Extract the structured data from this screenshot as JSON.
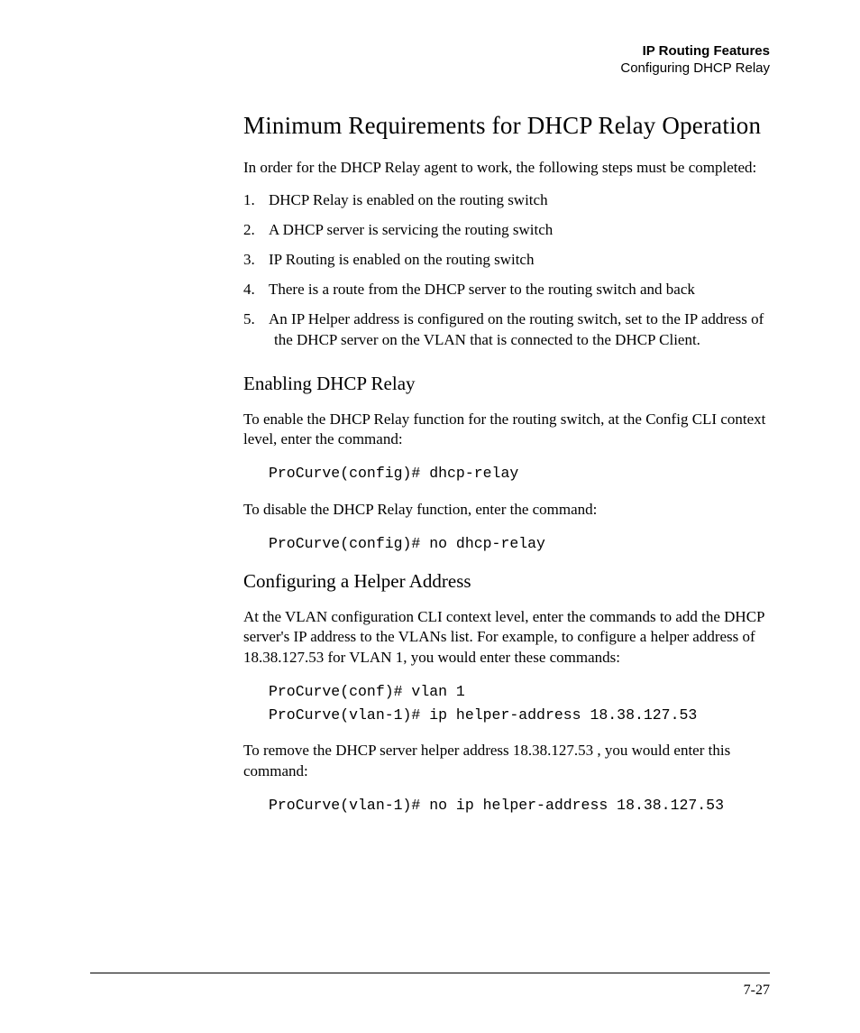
{
  "runningHead": {
    "bold": "IP Routing Features",
    "sub": "Configuring DHCP Relay"
  },
  "title": "Minimum Requirements for DHCP Relay Operation",
  "intro": "In order for the DHCP Relay agent to work, the following steps must be completed:",
  "requirements": [
    "DHCP Relay is enabled on the routing switch",
    "A DHCP server is servicing the routing switch",
    "IP Routing is enabled on the routing switch",
    "There is a route from the DHCP server to the routing switch and back",
    "An IP Helper address is configured on the routing switch, set to the IP address of the DHCP server on the VLAN that is connected to the DHCP Client."
  ],
  "enable": {
    "heading": "Enabling DHCP Relay",
    "p1": "To enable the DHCP Relay function for the routing switch, at the Config CLI context level, enter the command:",
    "cmd1": "ProCurve(config)# dhcp-relay",
    "p2": "To disable the DHCP Relay function, enter the command:",
    "cmd2": "ProCurve(config)# no dhcp-relay"
  },
  "helper": {
    "heading": "Configuring a Helper Address",
    "p1": "At the VLAN configuration CLI context level, enter the commands to add the DHCP server's IP address to the VLANs list. For example, to configure a helper address of 18.38.127.53 for VLAN 1, you would enter these commands:",
    "cmd1": "ProCurve(conf)# vlan 1\nProCurve(vlan-1)# ip helper-address 18.38.127.53",
    "p2": "To remove the DHCP server helper address 18.38.127.53 , you would enter this command:",
    "cmd2": "ProCurve(vlan-1)# no ip helper-address 18.38.127.53"
  },
  "pageNumber": "7-27"
}
